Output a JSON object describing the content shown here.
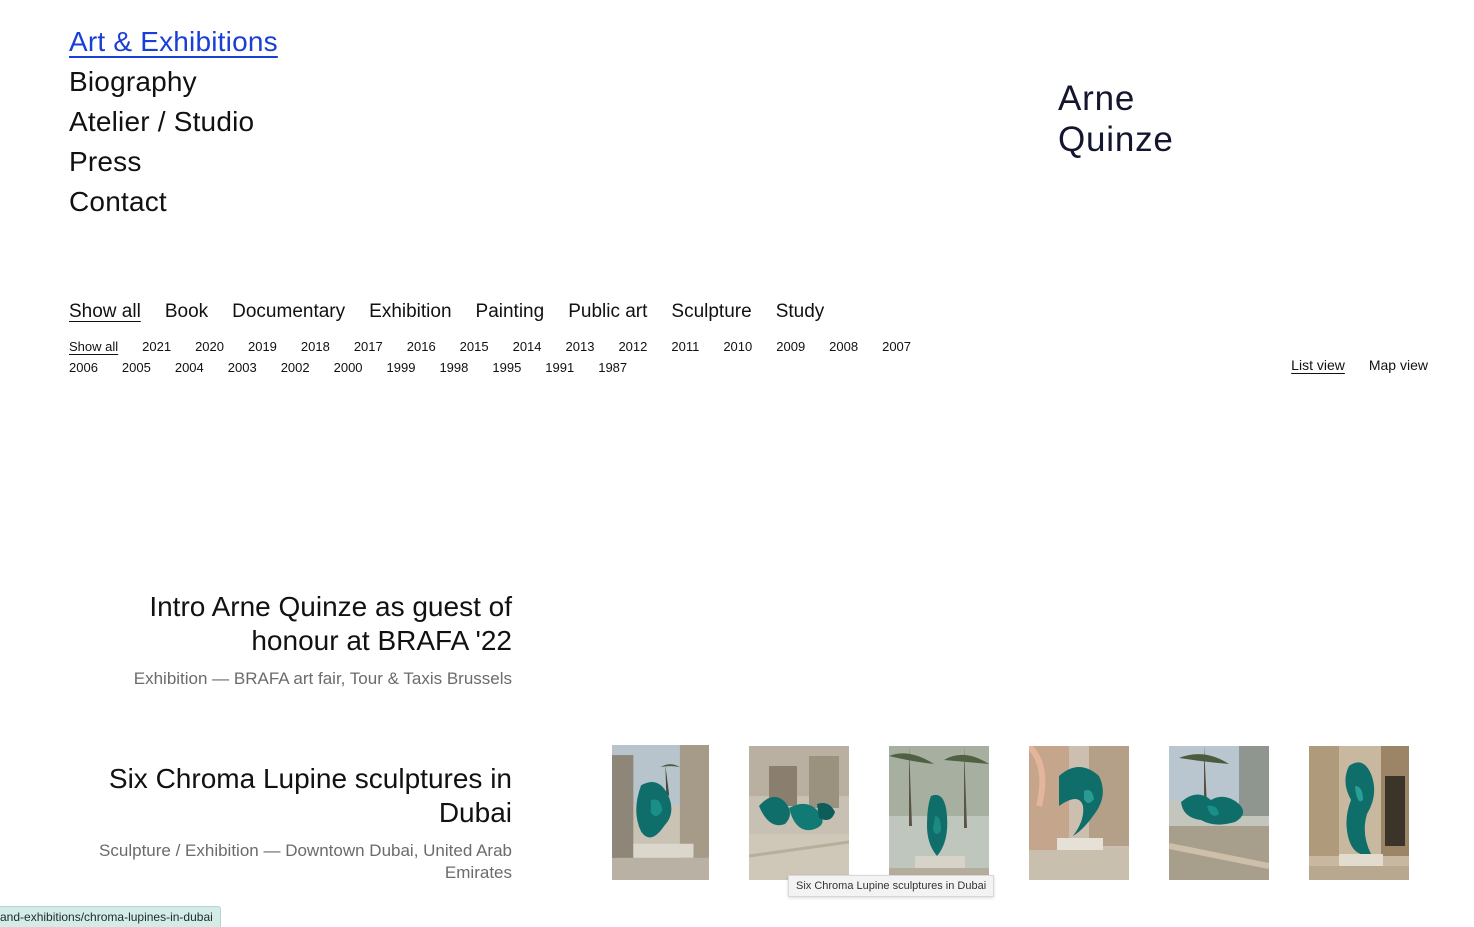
{
  "nav": {
    "items": [
      {
        "label": "Art & Exhibitions",
        "active": true
      },
      {
        "label": "Biography"
      },
      {
        "label": "Atelier / Studio"
      },
      {
        "label": "Press"
      },
      {
        "label": "Contact"
      }
    ]
  },
  "logo": {
    "line1": "Arne",
    "line2": "Quinze"
  },
  "filters": {
    "categories": [
      "Show all",
      "Book",
      "Documentary",
      "Exhibition",
      "Painting",
      "Public art",
      "Sculpture",
      "Study"
    ],
    "years": [
      "Show all",
      "2021",
      "2020",
      "2019",
      "2018",
      "2017",
      "2016",
      "2015",
      "2014",
      "2013",
      "2012",
      "2011",
      "2010",
      "2009",
      "2008",
      "2007",
      "2006",
      "2005",
      "2004",
      "2003",
      "2002",
      "2000",
      "1999",
      "1998",
      "1995",
      "1991",
      "1987"
    ]
  },
  "views": {
    "list": "List view",
    "map": "Map view"
  },
  "entries": [
    {
      "title": "Intro Arne Quinze as guest of honour at BRAFA '22",
      "subtitle": "Exhibition — BRAFA art fair, Tour & Taxis Brussels"
    },
    {
      "title": "Six Chroma Lupine sculptures in Dubai",
      "subtitle": "Sculpture / Exhibition — Downtown Dubai, United Arab Emirates"
    }
  ],
  "tooltip": "Six Chroma Lupine sculptures in Dubai",
  "statusbar": "and-exhibitions/chroma-lupines-in-dubai",
  "colors": {
    "accent": "#1a3fd6",
    "sculpture": "#0f6e6a",
    "muted": "#6b6b6b"
  }
}
